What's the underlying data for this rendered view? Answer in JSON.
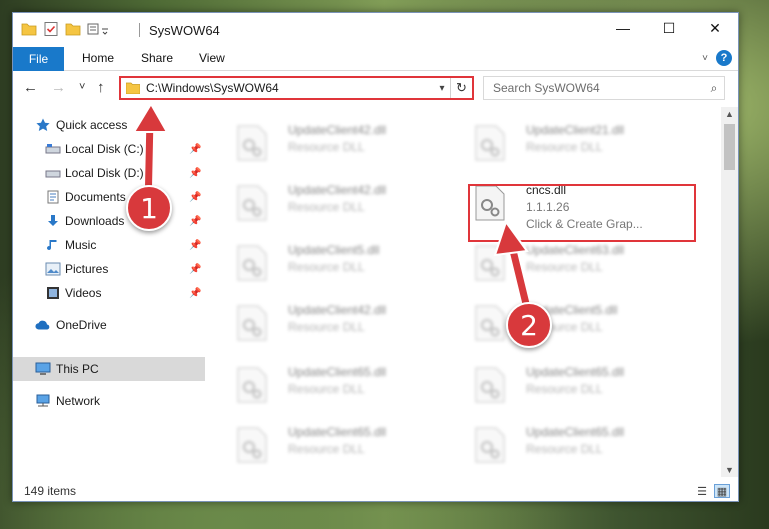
{
  "window": {
    "title": "SysWOW64",
    "controls": {
      "minimize": "—",
      "maximize": "☐",
      "close": "✕"
    }
  },
  "ribbon": {
    "tabs": [
      "File",
      "Home",
      "Share",
      "View"
    ],
    "collapse_icon": "chevron-down-icon",
    "help_label": "?"
  },
  "navigation": {
    "back": "←",
    "forward": "→",
    "recent": "˅",
    "up": "↑",
    "address": "C:\\Windows\\SysWOW64",
    "address_dropdown": "▾",
    "refresh": "↻",
    "search_placeholder": "Search SysWOW64",
    "search_icon": "⌕"
  },
  "sidebar": {
    "items": [
      {
        "label": "Quick access",
        "icon": "star-icon",
        "pinned": false,
        "selected": false
      },
      {
        "label": "Local Disk (C:)",
        "icon": "drive-icon",
        "pinned": true,
        "selected": false
      },
      {
        "label": "Local Disk (D:)",
        "icon": "drive-icon",
        "pinned": true,
        "selected": false
      },
      {
        "label": "Documents",
        "icon": "documents-icon",
        "pinned": true,
        "selected": false
      },
      {
        "label": "Downloads",
        "icon": "download-icon",
        "pinned": true,
        "selected": false
      },
      {
        "label": "Music",
        "icon": "music-icon",
        "pinned": true,
        "selected": false
      },
      {
        "label": "Pictures",
        "icon": "pictures-icon",
        "pinned": true,
        "selected": false
      },
      {
        "label": "Videos",
        "icon": "videos-icon",
        "pinned": true,
        "selected": false
      },
      {
        "label": "OneDrive",
        "icon": "cloud-icon",
        "pinned": false,
        "selected": false
      },
      {
        "label": "This PC",
        "icon": "computer-icon",
        "pinned": false,
        "selected": true
      },
      {
        "label": "Network",
        "icon": "network-icon",
        "pinned": false,
        "selected": false
      }
    ]
  },
  "files": {
    "left_column": [
      {
        "name": "UpdateClient42.dll",
        "type": "Resource DLL"
      },
      {
        "name": "UpdateClient42.dll",
        "type": "Resource DLL"
      },
      {
        "name": "UpdateClient5.dll",
        "type": "Resource DLL"
      },
      {
        "name": "UpdateClient42.dll",
        "type": "Resource DLL"
      },
      {
        "name": "UpdateClient65.dll",
        "type": "Resource DLL"
      },
      {
        "name": "UpdateClient65.dll",
        "type": "Resource DLL"
      }
    ],
    "right_column": [
      {
        "name": "UpdateClient21.dll",
        "type": "Resource DLL"
      },
      {
        "name": "UpdateClient63.dll",
        "type": "Resource DLL"
      },
      {
        "name": "UpdateClient5.dll",
        "type": "Resource DLL"
      },
      {
        "name": "UpdateClient65.dll",
        "type": "Resource DLL"
      },
      {
        "name": "UpdateClient65.dll",
        "type": "Resource DLL"
      }
    ],
    "highlighted": {
      "name": "cncs.dll",
      "version": "1.1.1.26",
      "description": "Click & Create Grap..."
    }
  },
  "status": {
    "item_count": "149 items"
  },
  "annotations": {
    "badge_1": "1",
    "badge_2": "2",
    "color": "#e0353a"
  }
}
